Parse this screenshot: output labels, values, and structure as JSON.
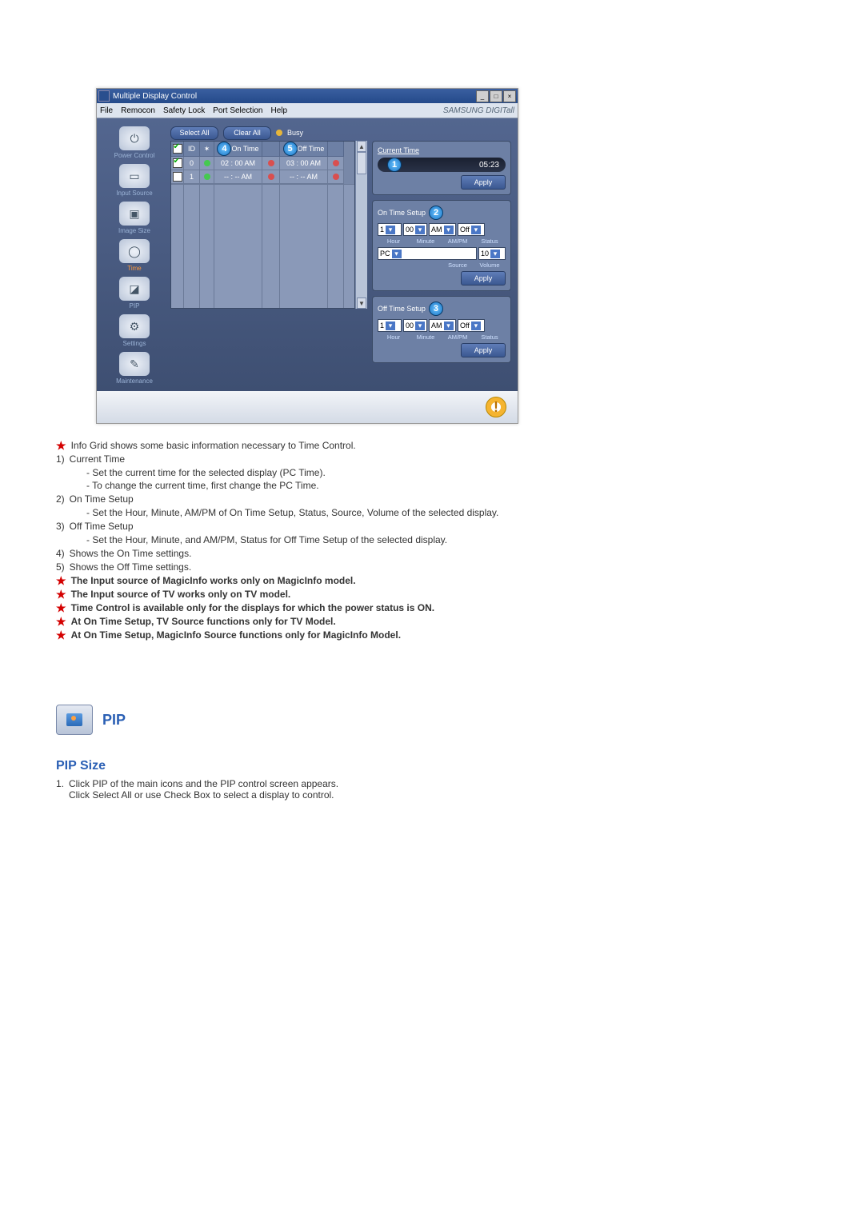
{
  "app": {
    "title": "Multiple Display Control",
    "menus": [
      "File",
      "Remocon",
      "Safety Lock",
      "Port Selection",
      "Help"
    ],
    "brand": "SAMSUNG DIGITall"
  },
  "sidebar": [
    {
      "label": "Power Control",
      "glyph": "⏻"
    },
    {
      "label": "Input Source",
      "glyph": "▭"
    },
    {
      "label": "Image Size",
      "glyph": "▣"
    },
    {
      "label": "Time",
      "glyph": "◯"
    },
    {
      "label": "PIP",
      "glyph": "◪"
    },
    {
      "label": "Settings",
      "glyph": "⚙"
    },
    {
      "label": "Maintenance",
      "glyph": "✎"
    }
  ],
  "topbtns": {
    "select_all": "Select All",
    "clear_all": "Clear All",
    "busy": "Busy"
  },
  "grid": {
    "cols": [
      "☑",
      "ID",
      "",
      "On Time",
      "",
      "Off Time",
      ""
    ],
    "rows": [
      {
        "chk": true,
        "id": "0",
        "led": "g",
        "on": "02 : 00 AM",
        "s1": "r",
        "off": "03 : 00 AM",
        "s2": "r"
      },
      {
        "chk": false,
        "id": "1",
        "led": "g",
        "on": "-- : -- AM",
        "s1": "r",
        "off": "-- : -- AM",
        "s2": "r"
      }
    ],
    "badge_on": "4",
    "badge_off": "5"
  },
  "right": {
    "current_time_hdr": "Current Time",
    "current_time_val": "05:23",
    "badge1": "1",
    "apply": "Apply",
    "on_hdr": "On Time Setup",
    "badge2": "2",
    "hour": "1",
    "minute": "00",
    "ampm": "AM",
    "status": "Off",
    "labels": {
      "hour": "Hour",
      "minute": "Minute",
      "ampm": "AM/PM",
      "status": "Status",
      "source": "Source",
      "volume": "Volume"
    },
    "source": "PC",
    "volume": "10",
    "off_hdr": "Off Time Setup",
    "badge3": "3",
    "off_hour": "1",
    "off_minute": "00",
    "off_ampm": "AM",
    "off_status": "Off"
  },
  "doc": {
    "line1": "Info Grid shows some basic information necessary to Time Control.",
    "items": [
      {
        "n": "1)",
        "t": "Current Time",
        "subs": [
          "- Set the current time for the selected display (PC Time).",
          "- To change the current time, first change the PC Time."
        ]
      },
      {
        "n": "2)",
        "t": "On Time Setup",
        "subs": [
          "- Set the Hour, Minute, AM/PM of On Time Setup, Status, Source, Volume of the selected display."
        ]
      },
      {
        "n": "3)",
        "t": "Off Time Setup",
        "subs": [
          "- Set the Hour, Minute, and AM/PM, Status for Off Time Setup of the selected display."
        ]
      },
      {
        "n": "4)",
        "t": "Shows the On Time settings.",
        "subs": []
      },
      {
        "n": "5)",
        "t": "Shows the Off Time settings.",
        "subs": []
      }
    ],
    "bolds": [
      "The Input source of MagicInfo works only on MagicInfo model.",
      "The Input source of TV works only on TV model.",
      "Time Control is available only for the displays for which the power status is ON.",
      "At On Time Setup, TV Source functions only for TV Model.",
      "At On Time Setup, MagicInfo Source functions only for MagicInfo Model."
    ],
    "pip_title": "PIP",
    "pip_sub": "PIP Size",
    "pip_ol_n": "1.",
    "pip_ol_a": "Click PIP of the main icons and the PIP control screen appears.",
    "pip_ol_b": "Click Select All or use Check Box to select a display to control."
  }
}
